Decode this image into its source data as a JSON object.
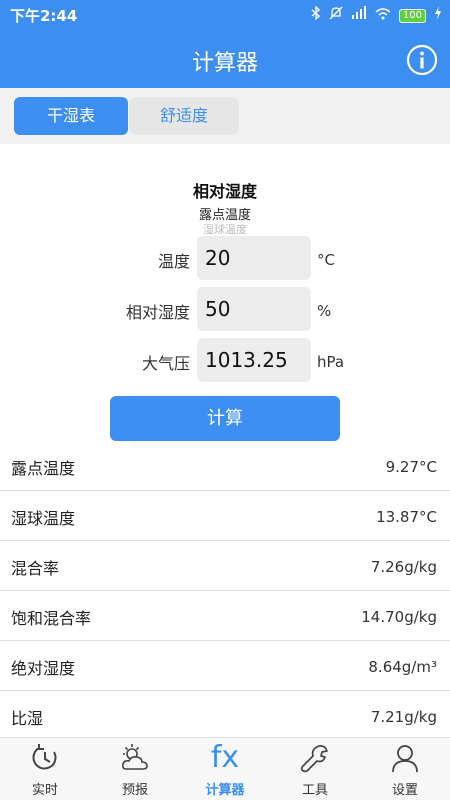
{
  "status_bar": {
    "time": "下午2:44",
    "battery": "100"
  },
  "app": {
    "title": "计算器"
  },
  "tabs": [
    {
      "label": "干湿表",
      "active": true
    },
    {
      "label": "舒适度",
      "active": false
    }
  ],
  "form": {
    "title": "相对湿度",
    "subtitle": "露点温度",
    "subtitle2": "湿球温度",
    "fields": [
      {
        "label": "温度",
        "value": "20",
        "unit": "°C"
      },
      {
        "label": "相对湿度",
        "value": "50",
        "unit": "%"
      },
      {
        "label": "大气压",
        "value": "1013.25",
        "unit": "hPa"
      }
    ],
    "calc_button": "计算"
  },
  "results": [
    {
      "label": "露点温度",
      "value": "9.27°C"
    },
    {
      "label": "湿球温度",
      "value": "13.87°C"
    },
    {
      "label": "混合率",
      "value": "7.26g/kg"
    },
    {
      "label": "饱和混合率",
      "value": "14.70g/kg"
    },
    {
      "label": "绝对湿度",
      "value": "8.64g/m³"
    },
    {
      "label": "比湿",
      "value": "7.21g/kg"
    }
  ],
  "bottom_nav": [
    {
      "label": "实时",
      "icon": "realtime-icon"
    },
    {
      "label": "预报",
      "icon": "forecast-icon"
    },
    {
      "label": "计算器",
      "icon": "fx-icon",
      "active": true,
      "glyph": "fx"
    },
    {
      "label": "工具",
      "icon": "wrench-icon"
    },
    {
      "label": "设置",
      "icon": "person-icon"
    }
  ],
  "colors": {
    "primary": "#3c8ef0",
    "tab_bg": "#f2f2f2",
    "field_bg": "#ececec"
  }
}
